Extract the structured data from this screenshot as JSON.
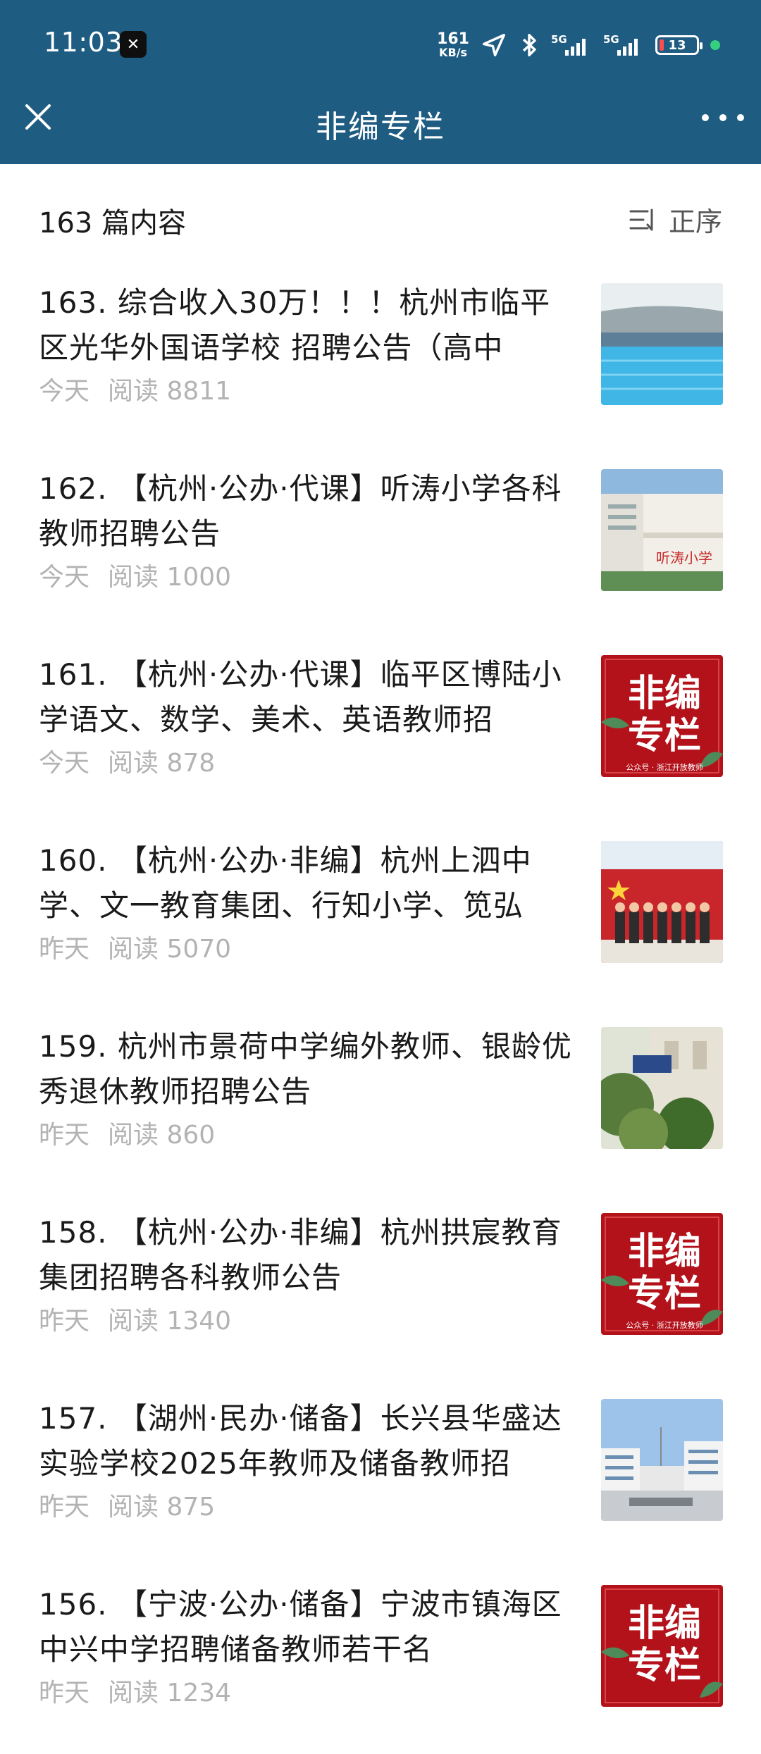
{
  "status_bar": {
    "time": "11:03",
    "speed_value": "161",
    "speed_unit": "KB/s",
    "signal_1": "5G",
    "signal_2": "5G",
    "battery": "13"
  },
  "nav": {
    "title": "非编专栏"
  },
  "summary": {
    "count": "163 篇内容",
    "sort_label": "正序"
  },
  "articles": [
    {
      "title": "163. 综合收入30万！！！杭州市临平区光华外国语学校 招聘公告（高中",
      "date": "今天",
      "reads": "阅读 8811",
      "thumb": "pool"
    },
    {
      "title": "162. 【杭州·公办·代课】听涛小学各科教师招聘公告",
      "date": "今天",
      "reads": "阅读 1000",
      "thumb": "school"
    },
    {
      "title": "161. 【杭州·公办·代课】临平区博陆小学语文、数学、美术、英语教师招",
      "date": "今天",
      "reads": "阅读 878",
      "thumb": "red-card"
    },
    {
      "title": "160. 【杭州·公办·非编】杭州上泗中学、文一教育集团、行知小学、笕弘",
      "date": "昨天",
      "reads": "阅读 5070",
      "thumb": "flag-group"
    },
    {
      "title": "159. 杭州市景荷中学编外教师、银龄优秀退休教师招聘公告",
      "date": "昨天",
      "reads": "阅读 860",
      "thumb": "trees"
    },
    {
      "title": "158. 【杭州·公办·非编】杭州拱宸教育集团招聘各科教师公告",
      "date": "昨天",
      "reads": "阅读 1340",
      "thumb": "red-card"
    },
    {
      "title": "157. 【湖州·民办·储备】长兴县华盛达实验学校2025年教师及储备教师招",
      "date": "昨天",
      "reads": "阅读 875",
      "thumb": "campus"
    },
    {
      "title": "156. 【宁波·公办·储备】宁波市镇海区中兴中学招聘储备教师若干名",
      "date": "昨天",
      "reads": "阅读 1234",
      "thumb": "red-card"
    }
  ],
  "red_card": {
    "line1": "非编",
    "line2": "专栏",
    "footer": "公众号 · 浙江开放教师"
  },
  "thumb_labels": {
    "school_sign": "听涛小学"
  },
  "colors": {
    "header_bg": "#1f5c82",
    "meta_text": "#b3b3b3",
    "red_card": "#b3121b"
  }
}
